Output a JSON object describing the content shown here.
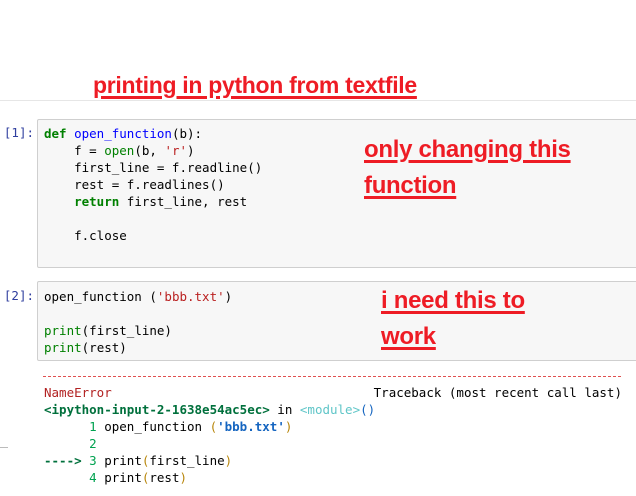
{
  "annotations": {
    "title": "printing in python from textfile",
    "note_function": "only changing this function",
    "note_call": "i need this  to work"
  },
  "cells": [
    {
      "prompt": "[1]:",
      "code": {
        "l1_kw": "def",
        "l1_fn": "open_function",
        "l1_rest": "(b):",
        "l2_a": "    f = ",
        "l2_fn": "open",
        "l2_b": "(b, ",
        "l2_str": "'r'",
        "l2_c": ")",
        "l3": "    first_line = f.readline()",
        "l4": "    rest = f.readlines()",
        "l5_kw": "return",
        "l5_rest": " first_line, rest",
        "l7": "    f.close"
      }
    },
    {
      "prompt": "[2]:",
      "code": {
        "l1_a": "open_function (",
        "l1_str": "'bbb.txt'",
        "l1_b": ")",
        "l3_fn": "print",
        "l3_rest": "(first_line)",
        "l4_fn": "print",
        "l4_rest": "(rest)"
      }
    }
  ],
  "output": {
    "dashes": "---------------------------------------------------------------------------",
    "error_name": "NameError",
    "traceback_label": "Traceback (most recent call last)",
    "input_ref": "<ipython-input-2-1638e54ac5ec>",
    "in_word": " in ",
    "module": "<module>",
    "module_parens": "()",
    "lines": [
      {
        "prefix": "      ",
        "num": "1",
        "a": " open_function ",
        "p1": "(",
        "str": "'bbb.txt'",
        "p2": ")"
      },
      {
        "prefix": "      ",
        "num": "2"
      },
      {
        "prefix": "----> ",
        "num": "3",
        "a": " print",
        "p1": "(",
        "arg": "first_line",
        "p2": ")"
      },
      {
        "prefix": "      ",
        "num": "4",
        "a": " print",
        "p1": "(",
        "arg": "rest",
        "p2": ")"
      }
    ]
  }
}
